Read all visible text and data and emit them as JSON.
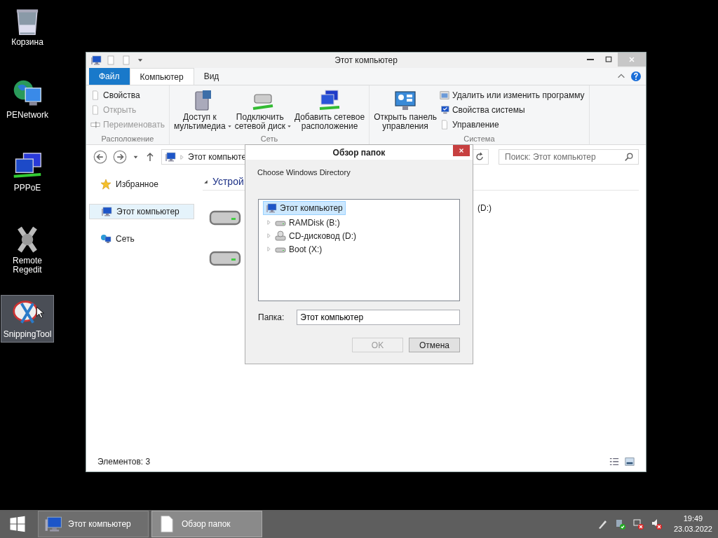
{
  "desktop_icons": [
    {
      "label": "Корзина",
      "selected": false
    },
    {
      "label": "PENetwork",
      "selected": false
    },
    {
      "label": "PPPoE",
      "selected": false
    },
    {
      "label": "Remote\nRegedit",
      "selected": false
    },
    {
      "label": "SnippingTool",
      "selected": true
    }
  ],
  "explorer": {
    "title": "Этот компьютер",
    "ribbon_tabs": [
      {
        "label": "Файл",
        "kind": "menu",
        "selected": false
      },
      {
        "label": "Компьютер",
        "kind": "tab",
        "selected": true
      },
      {
        "label": "Вид",
        "kind": "tab",
        "selected": false
      }
    ],
    "ribbon_groups": [
      {
        "label": "Расположение",
        "items": [
          {
            "label": "Свойства",
            "kind": "small",
            "disabled": false
          },
          {
            "label": "Открыть",
            "kind": "small",
            "disabled": true
          },
          {
            "label": "Переименовать",
            "kind": "small",
            "disabled": true
          }
        ]
      },
      {
        "label": "Сеть",
        "items": [
          {
            "label": "Доступ к\nмультимедиа",
            "kind": "large",
            "disabled": false,
            "dropdown": true
          },
          {
            "label": "Подключить\nсетевой диск",
            "kind": "large",
            "disabled": false,
            "dropdown": true
          },
          {
            "label": "Добавить сетевое\nрасположение",
            "kind": "large",
            "disabled": false,
            "dropdown": false
          }
        ]
      },
      {
        "label": "Система",
        "items": [
          {
            "label": "Открыть панель\nуправления",
            "kind": "large",
            "disabled": false,
            "dropdown": false
          },
          {
            "label": "Удалить или изменить программу",
            "kind": "small",
            "disabled": false
          },
          {
            "label": "Свойства системы",
            "kind": "small",
            "disabled": false
          },
          {
            "label": "Управление",
            "kind": "small",
            "disabled": false
          }
        ]
      }
    ],
    "address": "Этот компьюте",
    "search": {
      "placeholder": "Поиск: Этот компьютер"
    },
    "nav_items": [
      {
        "label": "Избранное",
        "selected": false
      },
      {
        "label": "Этот компьютер",
        "selected": true
      },
      {
        "label": "Сеть",
        "selected": false
      }
    ],
    "section_header": "Устрой",
    "tiles": [
      {
        "kind": "drive"
      },
      {
        "kind": "label",
        "label": "(D:)"
      },
      {
        "kind": "drive"
      }
    ],
    "status": "Элементов: 3"
  },
  "dialog": {
    "title": "Обзор папок",
    "prompt": "Choose Windows Directory",
    "tree": {
      "label": "Этот компьютер",
      "selected": true,
      "children": [
        {
          "label": "RAMDisk (B:)",
          "kind": "drive",
          "selected": false,
          "expanded": false
        },
        {
          "label": "CD-дисковод (D:)",
          "kind": "cd",
          "selected": false,
          "expanded": false
        },
        {
          "label": "Boot (X:)",
          "kind": "drive",
          "selected": false,
          "expanded": false
        }
      ]
    },
    "folder_label": "Папка:",
    "folder_value": "Этот компьютер",
    "buttons": [
      {
        "label": "OK",
        "disabled": true
      },
      {
        "label": "Отмена",
        "disabled": false
      }
    ]
  },
  "taskbar": {
    "buttons": [
      {
        "label": "Этот компьютер",
        "selected": false
      },
      {
        "label": "Обзор папок",
        "selected": true
      }
    ],
    "time": "19:49",
    "date": "23.03.2022"
  }
}
